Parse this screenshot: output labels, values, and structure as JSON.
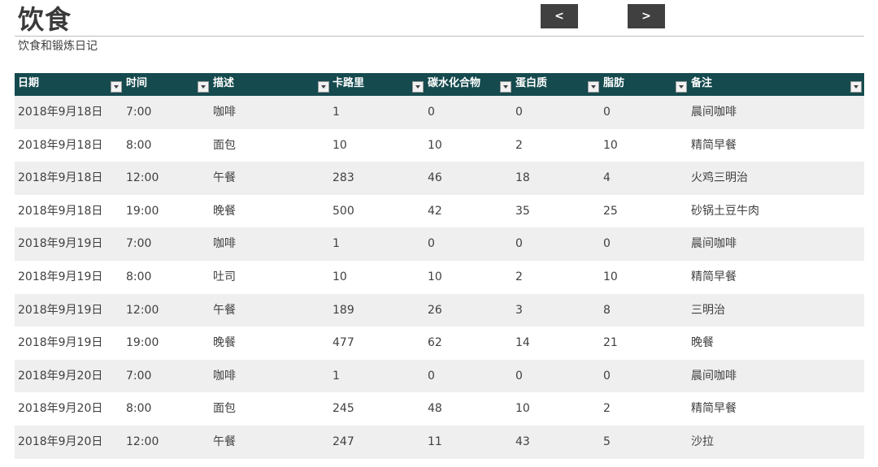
{
  "header": {
    "title": "饮食",
    "subtitle": "饮食和锻炼日记",
    "prev_label": "<",
    "next_label": ">"
  },
  "table": {
    "columns": [
      "日期",
      "时间",
      "描述",
      "卡路里",
      "碳水化合物",
      "蛋白质",
      "脂肪",
      "备注"
    ],
    "rows": [
      [
        "2018年9月18日",
        "7:00",
        "咖啡",
        "1",
        "0",
        "0",
        "0",
        "晨间咖啡"
      ],
      [
        "2018年9月18日",
        "8:00",
        "面包",
        "10",
        "10",
        "2",
        "10",
        "精简早餐"
      ],
      [
        "2018年9月18日",
        "12:00",
        "午餐",
        "283",
        "46",
        "18",
        "4",
        "火鸡三明治"
      ],
      [
        "2018年9月18日",
        "19:00",
        "晚餐",
        "500",
        "42",
        "35",
        "25",
        "砂锅土豆牛肉"
      ],
      [
        "2018年9月19日",
        "7:00",
        "咖啡",
        "1",
        "0",
        "0",
        "0",
        "晨间咖啡"
      ],
      [
        "2018年9月19日",
        "8:00",
        "吐司",
        "10",
        "10",
        "2",
        "10",
        "精简早餐"
      ],
      [
        "2018年9月19日",
        "12:00",
        "午餐",
        "189",
        "26",
        "3",
        "8",
        "三明治"
      ],
      [
        "2018年9月19日",
        "19:00",
        "晚餐",
        "477",
        "62",
        "14",
        "21",
        "晚餐"
      ],
      [
        "2018年9月20日",
        "7:00",
        "咖啡",
        "1",
        "0",
        "0",
        "0",
        "晨间咖啡"
      ],
      [
        "2018年9月20日",
        "8:00",
        "面包",
        "245",
        "48",
        "10",
        "2",
        "精简早餐"
      ],
      [
        "2018年9月20日",
        "12:00",
        "午餐",
        "247",
        "11",
        "43",
        "5",
        "沙拉"
      ]
    ]
  },
  "colors": {
    "header_bg": "#154a4e",
    "button_bg": "#404040",
    "row_band": "#efefef"
  }
}
